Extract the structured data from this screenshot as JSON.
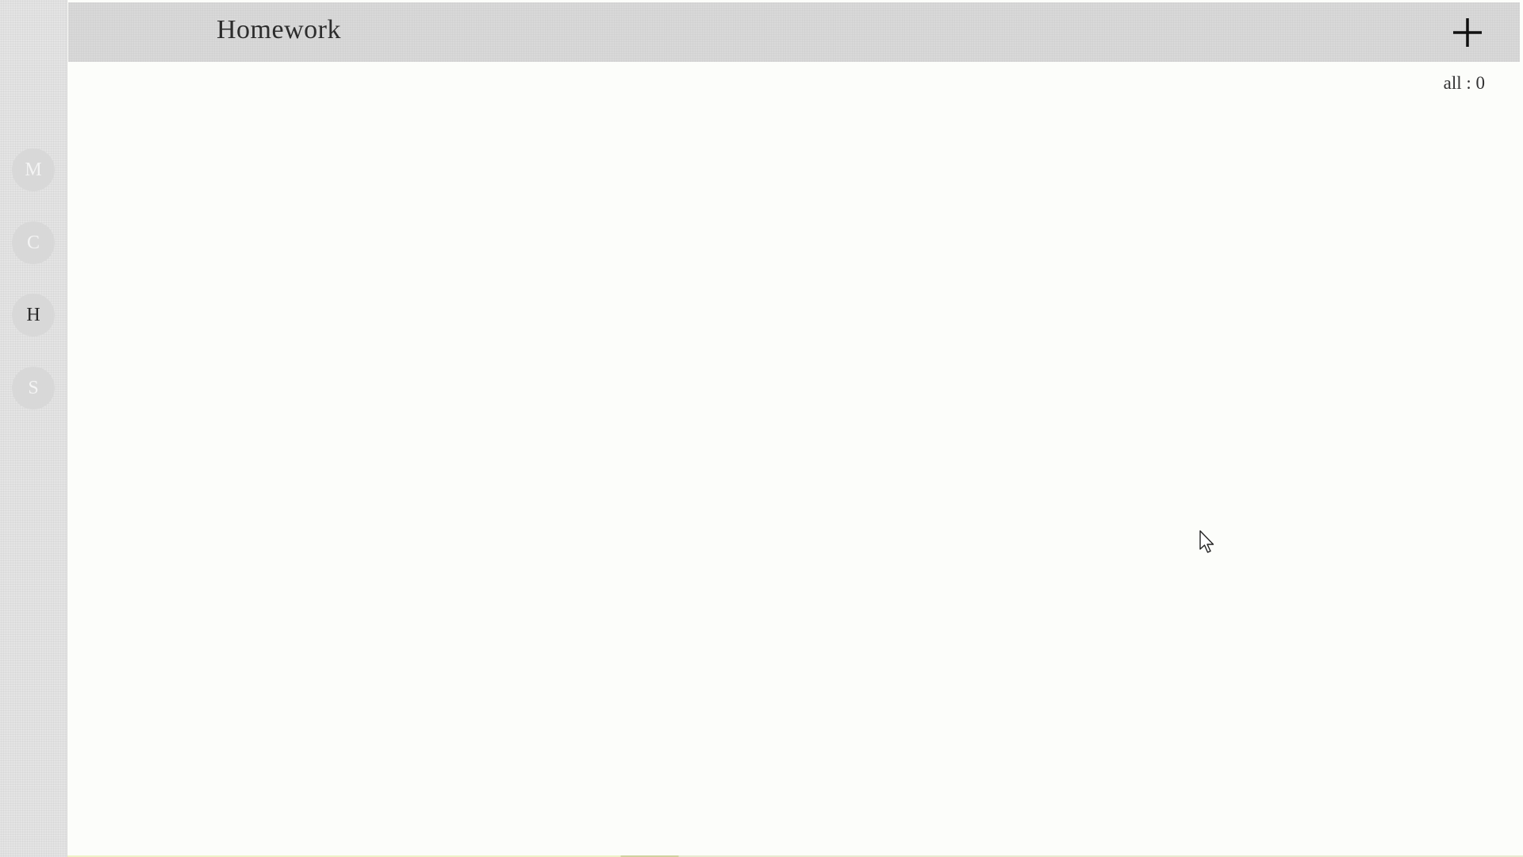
{
  "header": {
    "title": "Homework",
    "add_icon": "plus-icon"
  },
  "sidebar": {
    "items": [
      {
        "label": "M",
        "active": false
      },
      {
        "label": "C",
        "active": false
      },
      {
        "label": "H",
        "active": true
      },
      {
        "label": "S",
        "active": false
      }
    ]
  },
  "main": {
    "count_label": "all : 0"
  },
  "colors": {
    "sidebar_bg": "#e4e4e4",
    "topbar_bg": "#d9d9d9",
    "content_bg": "#fcfdfa",
    "nav_button_bg": "#d8d8d8",
    "nav_inactive_text": "#f4f4f4",
    "nav_active_text": "#2a2a2a"
  }
}
